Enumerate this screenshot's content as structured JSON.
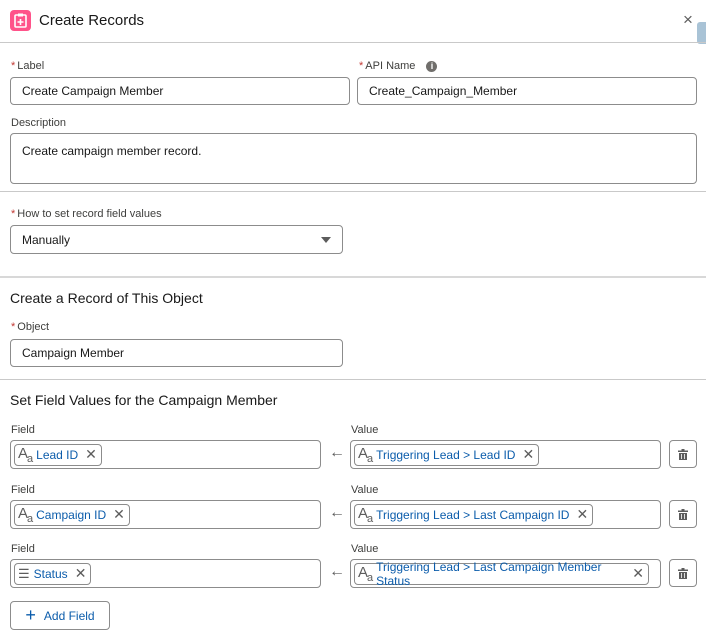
{
  "header": {
    "title": "Create Records",
    "close": "×"
  },
  "label": {
    "label": "Label",
    "value": "Create Campaign Member"
  },
  "api_name": {
    "label": "API Name",
    "value": "Create_Campaign_Member"
  },
  "description": {
    "label": "Description",
    "value": "Create campaign member record."
  },
  "how_to_set": {
    "label": "How to set record field values",
    "value": "Manually"
  },
  "object_section": {
    "title": "Create a Record of This Object",
    "label": "Object",
    "value": "Campaign Member"
  },
  "field_values": {
    "title": "Set Field Values for the Campaign Member",
    "field_label": "Field",
    "value_label": "Value",
    "rows": [
      {
        "field": "Lead ID",
        "field_icon": "text-icon",
        "value": "Triggering Lead > Lead ID"
      },
      {
        "field": "Campaign ID",
        "field_icon": "text-icon",
        "value": "Triggering Lead > Last Campaign ID"
      },
      {
        "field": "Status",
        "field_icon": "picklist-icon",
        "value": "Triggering Lead > Last Campaign Member Status"
      }
    ]
  },
  "add_field": "Add Field",
  "colors": {
    "accent": "#0b5cab",
    "header_icon": "#ff538a",
    "required": "#c23934"
  }
}
